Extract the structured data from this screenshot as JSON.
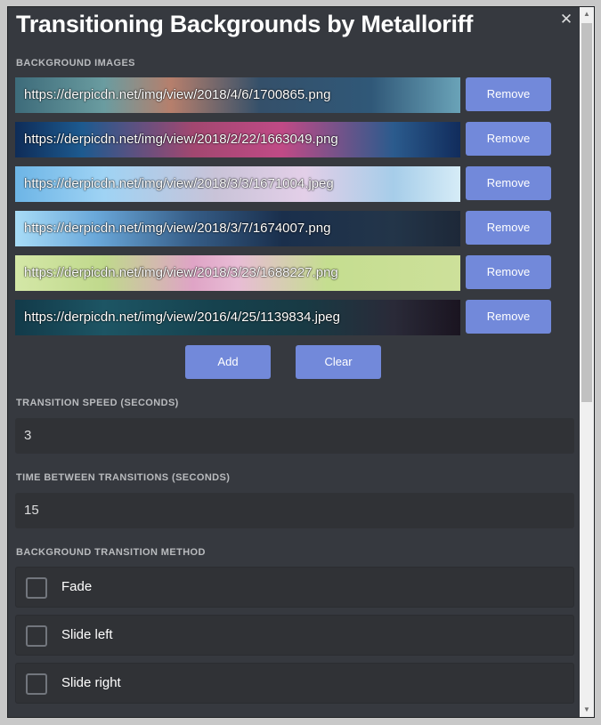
{
  "modal": {
    "title": "Transitioning Backgrounds by Metalloriff",
    "close_glyph": "✕"
  },
  "background_images": {
    "label": "Background Images",
    "remove_label": "Remove",
    "items": [
      {
        "url": "https://derpicdn.net/img/view/2018/4/6/1700865.png"
      },
      {
        "url": "https://derpicdn.net/img/view/2018/2/22/1663049.png"
      },
      {
        "url": "https://derpicdn.net/img/view/2018/3/3/1671004.jpeg"
      },
      {
        "url": "https://derpicdn.net/img/view/2018/3/7/1674007.png"
      },
      {
        "url": "https://derpicdn.net/img/view/2018/3/23/1688227.png"
      },
      {
        "url": "https://derpicdn.net/img/view/2016/4/25/1139834.jpeg"
      }
    ],
    "add_label": "Add",
    "clear_label": "Clear"
  },
  "transition_speed": {
    "label": "Transition Speed (seconds)",
    "value": "3"
  },
  "time_between": {
    "label": "Time Between Transitions (seconds)",
    "value": "15"
  },
  "transition_method": {
    "label": "Background Transition Method",
    "options": [
      {
        "label": "Fade",
        "checked": false
      },
      {
        "label": "Slide left",
        "checked": false
      },
      {
        "label": "Slide right",
        "checked": false
      }
    ]
  },
  "colors": {
    "modal_bg": "#36393f",
    "button": "#7289da",
    "field_bg": "#303236",
    "label": "#b9bbbe"
  }
}
